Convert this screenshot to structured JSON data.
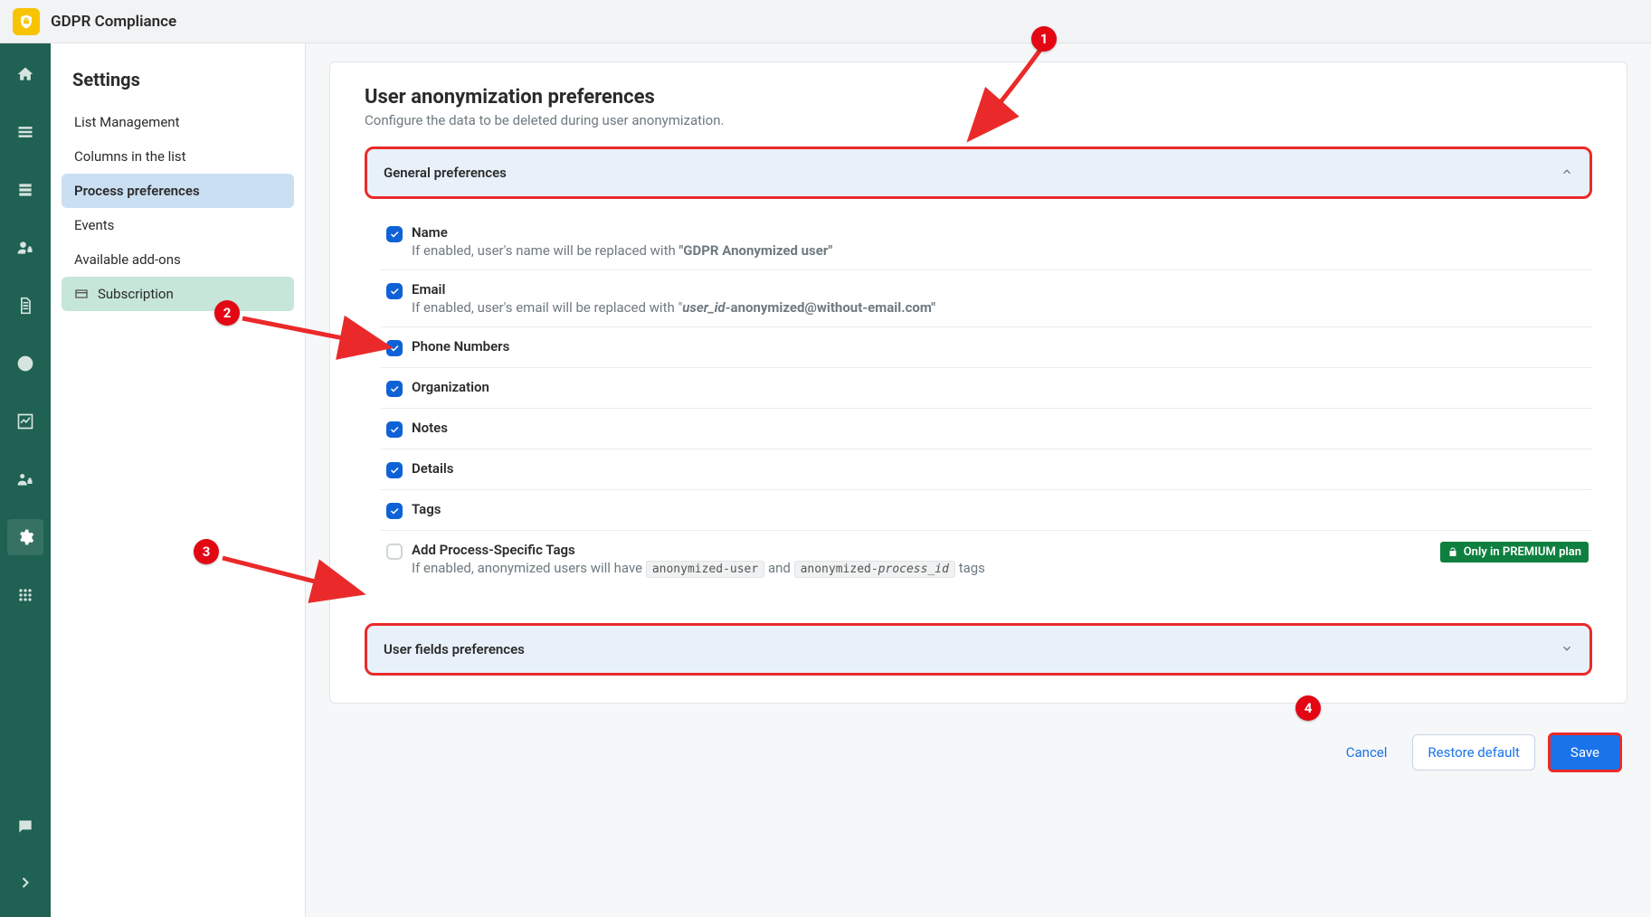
{
  "app_title": "GDPR Compliance",
  "settings_title": "Settings",
  "sidebar": {
    "items": [
      {
        "label": "List Management"
      },
      {
        "label": "Columns in the list"
      },
      {
        "label": "Process preferences"
      },
      {
        "label": "Events"
      },
      {
        "label": "Available add-ons"
      },
      {
        "label": "Subscription"
      }
    ]
  },
  "page": {
    "title": "User anonymization preferences",
    "subtitle": "Configure the data to be deleted during user anonymization."
  },
  "accordion": {
    "general": "General preferences",
    "userfields": "User fields preferences"
  },
  "prefs": {
    "name": {
      "label": "Name",
      "desc_prefix": "If enabled, user's name will be replaced with ",
      "desc_bold": "\"GDPR Anonymized user\""
    },
    "email": {
      "label": "Email",
      "desc_prefix": "If enabled, user's email will be replaced with \"",
      "desc_italic": "user_id",
      "desc_bold_rest": "-anonymized@without-email.com\""
    },
    "phone": {
      "label": "Phone Numbers"
    },
    "org": {
      "label": "Organization"
    },
    "notes": {
      "label": "Notes"
    },
    "details": {
      "label": "Details"
    },
    "tags": {
      "label": "Tags"
    },
    "process_tags": {
      "label": "Add Process-Specific Tags",
      "desc_prefix": "If enabled, anonymized users will have ",
      "tag1": "anonymized-user",
      "and": " and ",
      "tag2_prefix": "anonymized-",
      "tag2_italic": "process_id",
      "desc_suffix": " tags"
    }
  },
  "premium_badge": "Only in PREMIUM plan",
  "buttons": {
    "cancel": "Cancel",
    "restore": "Restore default",
    "save": "Save"
  },
  "markers": {
    "m1": "1",
    "m2": "2",
    "m3": "3",
    "m4": "4"
  }
}
